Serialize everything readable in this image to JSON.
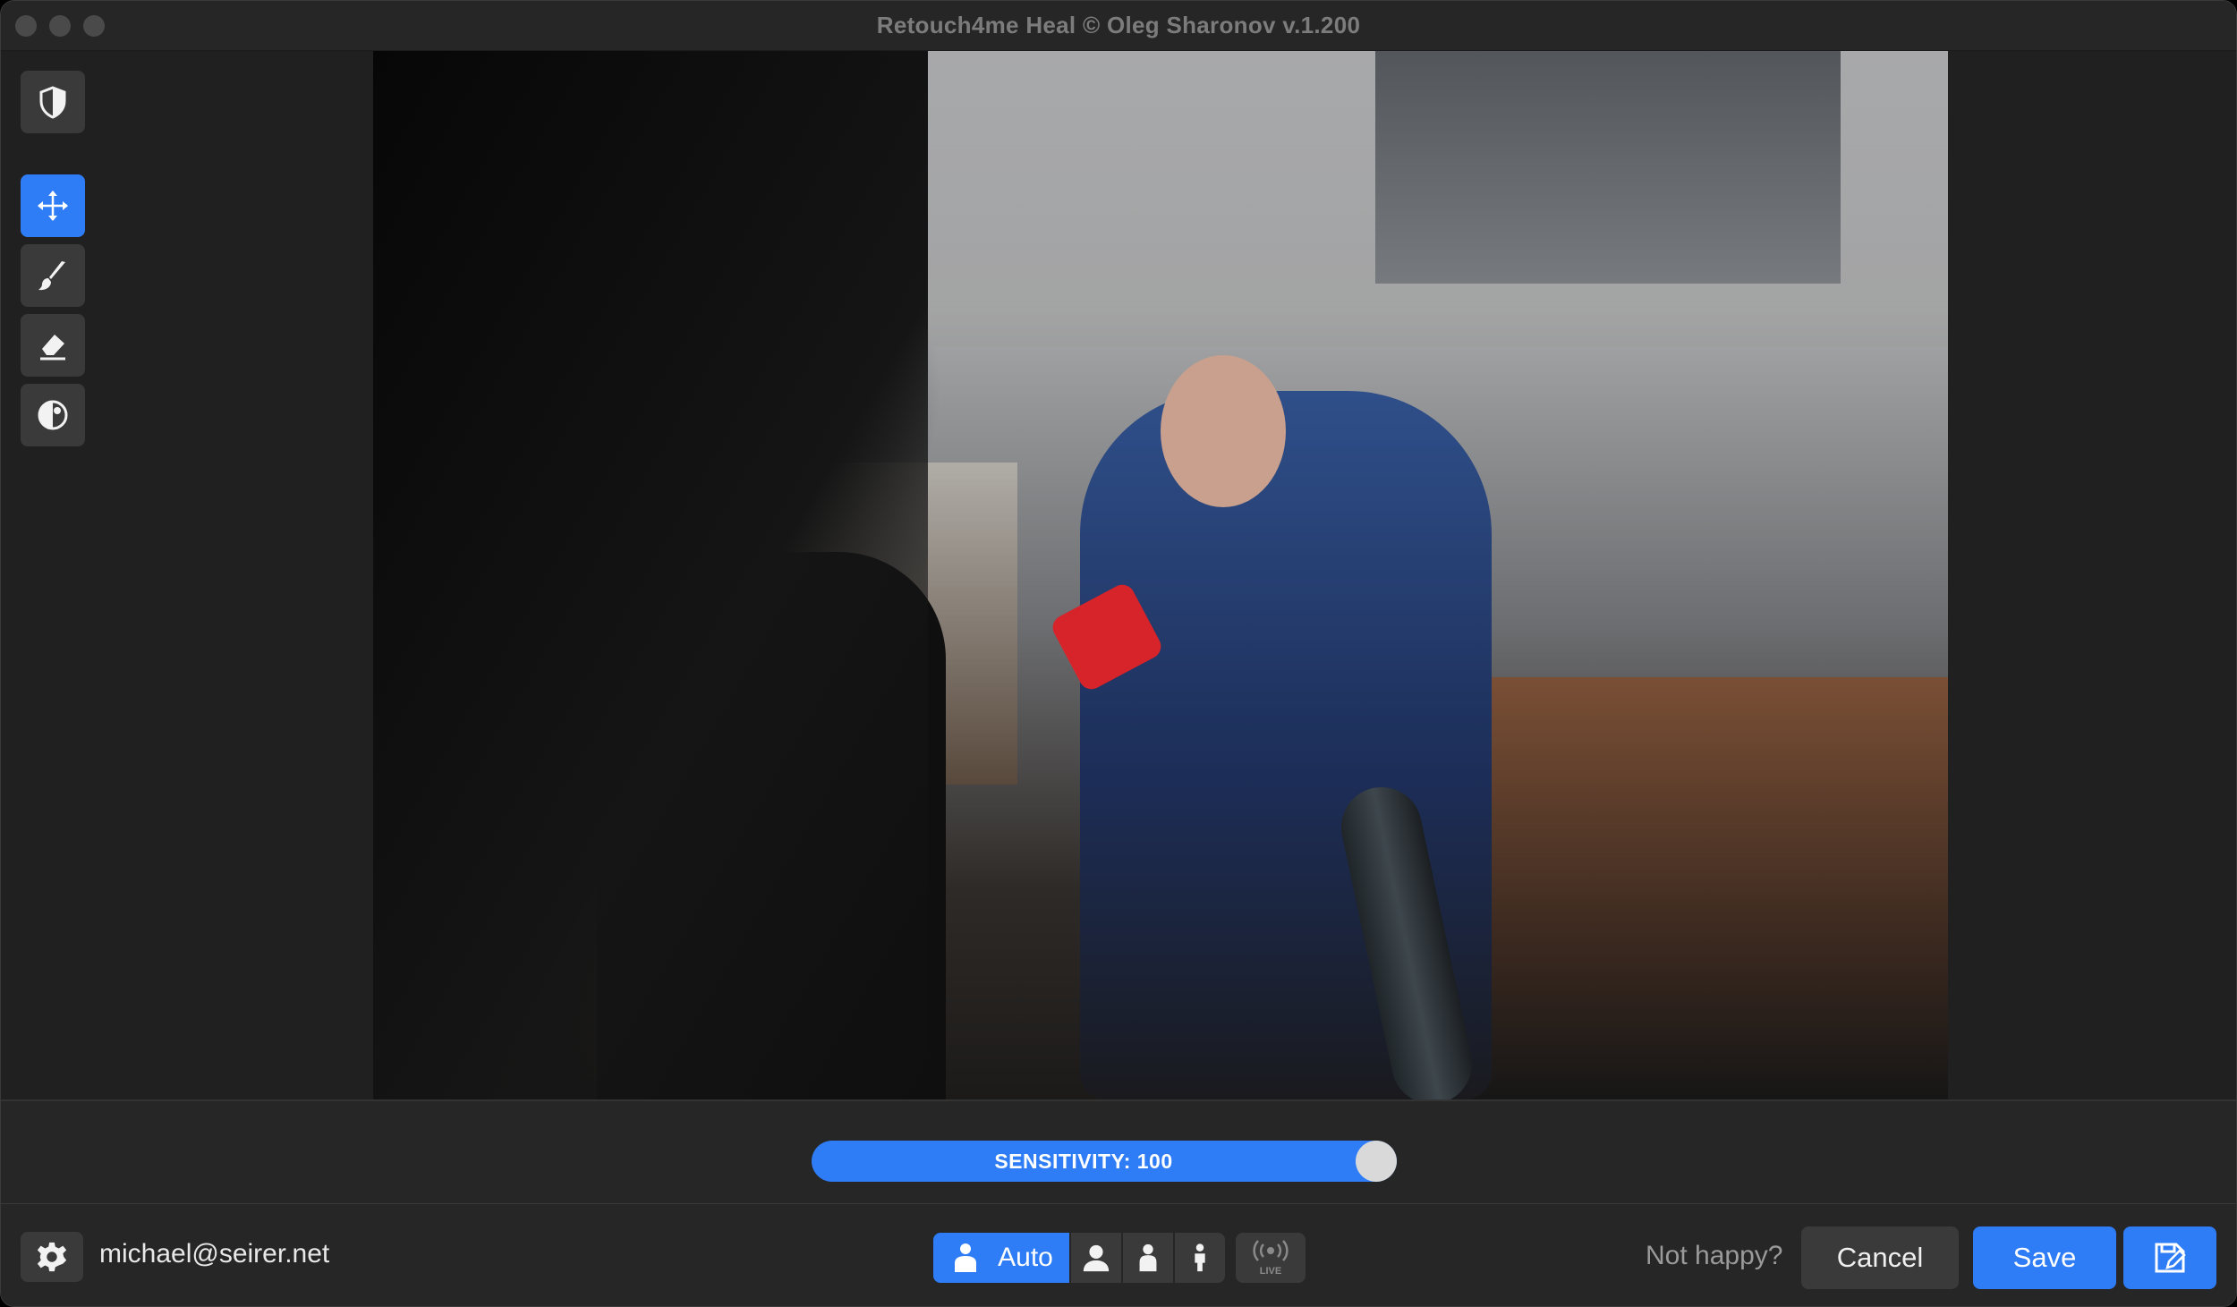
{
  "window": {
    "title": "Retouch4me Heal © Oleg Sharonov v.1.200"
  },
  "toolbar": {
    "tools": [
      {
        "name": "shield-icon",
        "active": false
      },
      {
        "name": "move-icon",
        "active": true
      },
      {
        "name": "brush-icon",
        "active": false
      },
      {
        "name": "eraser-icon",
        "active": false
      },
      {
        "name": "compare-icon",
        "active": false
      }
    ]
  },
  "canvas": {
    "description_icon": "photo"
  },
  "slider": {
    "label": "SENSITIVITY: 100",
    "value": 100,
    "max": 100
  },
  "footer": {
    "user": "michael@seirer.net",
    "modes": {
      "auto_label": "Auto",
      "icons": [
        "person-icon",
        "person-half-icon",
        "person-full-icon"
      ]
    },
    "live_label": "LIVE",
    "not_happy": "Not happy?",
    "cancel_label": "Cancel",
    "save_label": "Save"
  },
  "colors": {
    "accent": "#2f7df6",
    "background": "#262626",
    "button": "#3a3a3a"
  }
}
